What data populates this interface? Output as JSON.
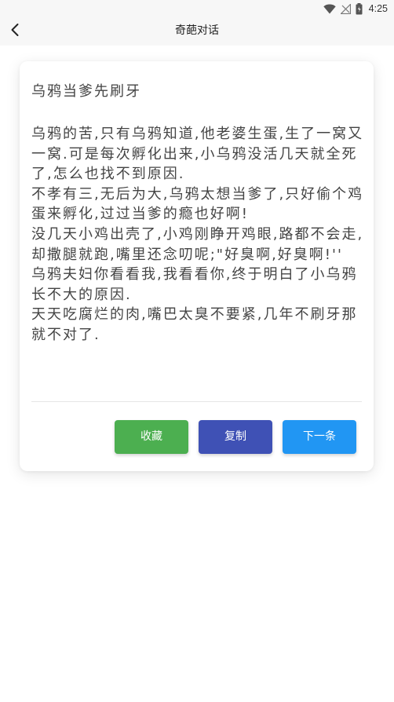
{
  "status_bar": {
    "time": "4:25",
    "icons": [
      "wifi-icon",
      "no-signal-icon",
      "battery-icon"
    ]
  },
  "app_bar": {
    "title": "奇葩对话",
    "back_icon": "chevron-left-icon"
  },
  "joke": {
    "title": "乌鸦当爹先刷牙",
    "body": "乌鸦的苦,只有乌鸦知道,他老婆生蛋,生了一窝又一窝.可是每次孵化出来,小乌鸦没活几天就全死了,怎么也找不到原因.\n不孝有三,无后为大,乌鸦太想当爹了,只好偷个鸡蛋来孵化,过过当爹的瘾也好啊!\n没几天小鸡出壳了,小鸡刚睁开鸡眼,路都不会走,却撒腿就跑,嘴里还念叨呢;\"好臭啊,好臭啊!''\n乌鸦夫妇你看看我,我看看你,终于明白了小乌鸦长不大的原因.\n天天吃腐烂的肉,嘴巴太臭不要紧,几年不刷牙那就不对了."
  },
  "actions": {
    "favorite_label": "收藏",
    "copy_label": "复制",
    "next_label": "下一条"
  },
  "colors": {
    "favorite": "#4caf50",
    "copy": "#3f51b5",
    "next": "#2196f3",
    "appbar_bg": "#f7f7f7"
  }
}
